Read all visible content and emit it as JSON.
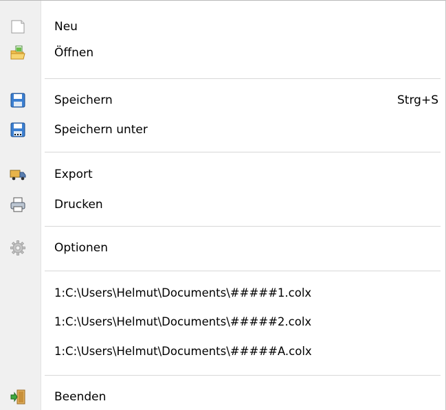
{
  "menu": {
    "items": [
      {
        "label": "Neu",
        "icon": "new-document-icon"
      },
      {
        "label": "Öffnen",
        "icon": "open-folder-icon"
      },
      {
        "label": "Speichern",
        "icon": "save-disk-icon",
        "shortcut": "Strg+S"
      },
      {
        "label": "Speichern unter",
        "icon": "save-as-disk-icon"
      },
      {
        "label": "Export",
        "icon": "export-truck-icon"
      },
      {
        "label": "Drucken",
        "icon": "printer-icon"
      },
      {
        "label": "Optionen",
        "icon": "gear-icon"
      },
      {
        "label": "Beenden",
        "icon": "exit-door-icon"
      }
    ],
    "recent": [
      "1:C:\\Users\\Helmut\\Documents\\#####1.colx",
      "1:C:\\Users\\Helmut\\Documents\\#####2.colx",
      "1:C:\\Users\\Helmut\\Documents\\#####A.colx"
    ]
  }
}
